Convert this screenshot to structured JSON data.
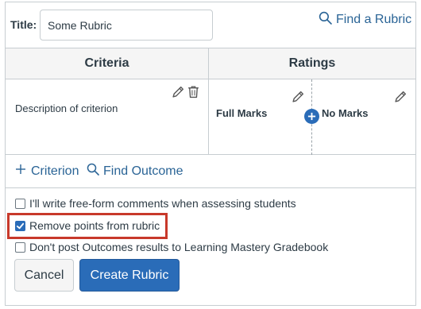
{
  "header": {
    "title_label": "Title:",
    "title_value": "Some Rubric",
    "find_rubric_label": "Find a Rubric"
  },
  "table": {
    "columns": [
      "Criteria",
      "Ratings"
    ],
    "criterion": {
      "description": "Description of criterion",
      "ratings": [
        "Full Marks",
        "No Marks"
      ]
    }
  },
  "actions": {
    "add_criterion": "Criterion",
    "find_outcome": "Find Outcome"
  },
  "options": [
    {
      "label": "I'll write free-form comments when assessing students",
      "checked": false
    },
    {
      "label": "Remove points from rubric",
      "checked": true
    },
    {
      "label": "Don't post Outcomes results to Learning Mastery Gradebook",
      "checked": false
    }
  ],
  "buttons": {
    "cancel": "Cancel",
    "create": "Create Rubric"
  },
  "colors": {
    "link": "#2a6496",
    "primary": "#2a6cb8",
    "highlight_border": "#c8392b",
    "text": "#2d3b45"
  },
  "icons": [
    "search-icon",
    "pencil-icon",
    "trash-icon",
    "plus-icon",
    "checkmark-icon"
  ]
}
